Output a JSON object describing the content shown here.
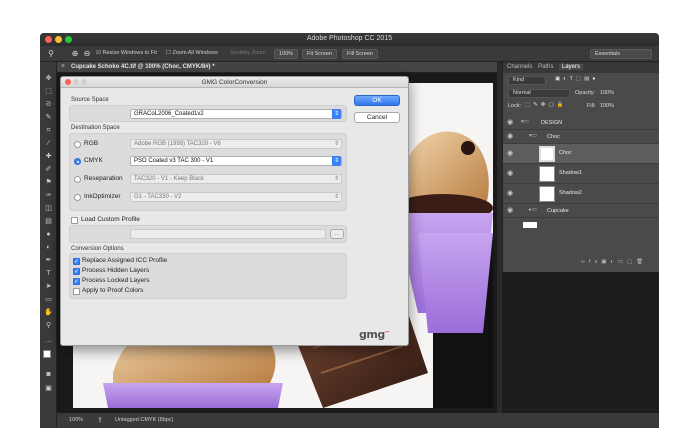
{
  "app": {
    "title": "Adobe Photoshop CC 2015",
    "workspace": "Essentials"
  },
  "options_bar": {
    "resize_windows": "Resize Windows to Fit",
    "zoom_all": "Zoom All Windows",
    "scrubby_zoom": "Scrubby Zoom",
    "zoom_value": "100%",
    "fit_screen": "Fit Screen",
    "fill_screen": "Fill Screen"
  },
  "document": {
    "tab_label": "Cupcake Schoko 4C.tif @ 100% (Choc, CMYK/8#) *",
    "status_zoom": "100%",
    "status_profile": "Untagged CMYK (8bpc)"
  },
  "layers_panel": {
    "tabs": [
      "Channels",
      "Paths",
      "Layers"
    ],
    "kind_filter": "Kind",
    "blend_mode": "Normal",
    "opacity_label": "Opacity:",
    "opacity_value": "100%",
    "lock_label": "Lock:",
    "fill_label": "Fill:",
    "fill_value": "100%",
    "layers": [
      {
        "name": "DESIGN"
      },
      {
        "name": "Choc"
      },
      {
        "name": "Choc"
      },
      {
        "name": "Shadow1"
      },
      {
        "name": "Shadow2"
      },
      {
        "name": "Cupcake"
      }
    ]
  },
  "dialog": {
    "title": "GMG ColorConversion",
    "source_space_label": "Source Space",
    "source_space_value": "GRACoL2006_Coated1v2",
    "destination_label": "Destination Space",
    "rgb_label": "RGB",
    "rgb_value": "Adobe RGB (1998) TAC320 - V6",
    "cmyk_label": "CMYK",
    "cmyk_value": "PSO Coated v3 TAC 300 - V1",
    "reseparation_label": "Reseparation",
    "reseparation_value": "TAC320 - V1 - Keep Black",
    "inkoptimizer_label": "InkOptimizer",
    "inkoptimizer_value": "G1 - TAC330 - V2",
    "load_custom_label": "Load Custom Profile",
    "browse_label": "...",
    "conversion_options_label": "Conversion Options",
    "options": [
      {
        "label": "Replace Assigned ICC Profile",
        "checked": true
      },
      {
        "label": "Process Hidden Layers",
        "checked": true
      },
      {
        "label": "Process Locked Layers",
        "checked": true
      },
      {
        "label": "Apply to Proof Colors",
        "checked": false
      }
    ],
    "ok_label": "OK",
    "cancel_label": "Cancel",
    "logo_text": "gmg",
    "selected_destination": "CMYK",
    "accent_color": "#3b82f6"
  }
}
